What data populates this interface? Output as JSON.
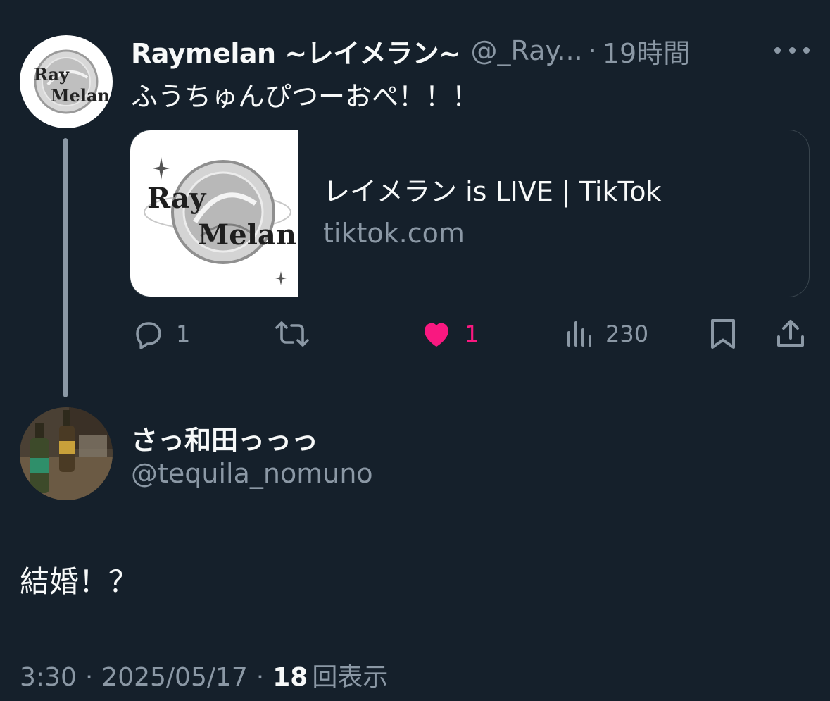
{
  "parent_tweet": {
    "display_name": "Raymelan ~レイメラン~",
    "handle": "@_Ray...",
    "separator": "·",
    "time_ago": "19時間",
    "avatar_logo_line1": "Ray",
    "avatar_logo_line2": "Melan",
    "text": "ふうちゅんぴつーおぺ！！！",
    "card": {
      "title": "レイメラン is LIVE | TikTok",
      "domain": "tiktok.com",
      "thumb_logo_line1": "Ray",
      "thumb_logo_line2": "Melan"
    },
    "actions": {
      "replies": "1",
      "likes": "1",
      "views": "230"
    }
  },
  "reply_tweet": {
    "display_name": "さっ和田っっっ",
    "handle": "@tequila_nomuno",
    "text": "結婚！？",
    "time": "3:30",
    "separator": "·",
    "date": "2025/05/17",
    "views_count": "18",
    "views_label": "回表示"
  },
  "colors": {
    "background": "#15202b",
    "primary_text": "#f7f9f9",
    "secondary_text": "#8b98a5",
    "like_pink": "#f91880",
    "border": "#38444d"
  },
  "icons": [
    "reply-icon",
    "retweet-icon",
    "heart-icon",
    "views-icon",
    "bookmark-icon",
    "share-icon",
    "more-icon"
  ]
}
